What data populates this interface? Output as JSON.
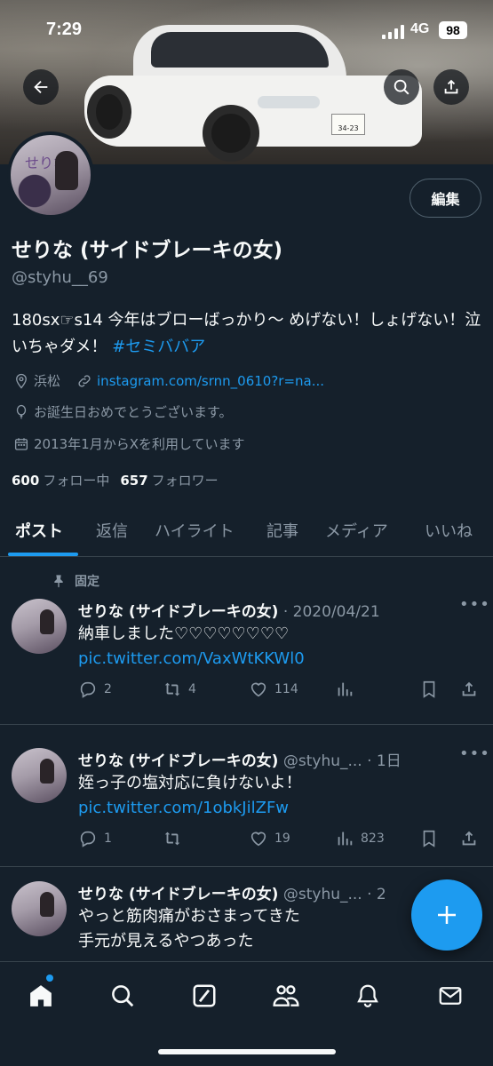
{
  "status_bar": {
    "time": "7:29",
    "network": "4G",
    "battery": "98"
  },
  "banner": {
    "plate_text": "34-23"
  },
  "header": {
    "edit_label": "編集"
  },
  "profile": {
    "display_name": "せりな (サイドブレーキの女)",
    "handle": "@styhu__69",
    "avatar_text": "せりな",
    "bio_text": "180sx☞s14 今年はブローばっかり〜 めげない！しょげない！泣いちゃダメ！ ",
    "bio_hashtag": "#セミババア",
    "location": "浜松",
    "website": "instagram.com/srnn_0610?r=na...",
    "birthday": "お誕生日おめでとうございます。",
    "joined": "2013年1月からXを利用しています",
    "following_count": "600",
    "following_label": "フォロー中",
    "followers_count": "657",
    "followers_label": "フォロワー"
  },
  "tabs": [
    {
      "label": "ポスト"
    },
    {
      "label": "返信"
    },
    {
      "label": "ハイライト"
    },
    {
      "label": "記事"
    },
    {
      "label": "メディア"
    },
    {
      "label": "いいね"
    }
  ],
  "pinned_label": "固定",
  "posts": [
    {
      "name": "せりな (サイドブレーキの女)",
      "meta": " · 2020/04/21",
      "text": "納車しました♡♡♡♡♡♡♡♡ ",
      "link": "pic.twitter.com/VaxWtKKWl0",
      "replies": "2",
      "reposts": "4",
      "likes": "114",
      "views": ""
    },
    {
      "name": "せりな (サイドブレーキの女)",
      "meta": " @styhu_... · 1日",
      "text": "姪っ子の塩対応に負けないよ！ ",
      "link": "pic.twitter.com/1obkJilZFw",
      "replies": "1",
      "reposts": "",
      "likes": "19",
      "views": "823"
    },
    {
      "name": "せりな (サイドブレーキの女)",
      "meta": " @styhu_... · 2",
      "line1": "やっと筋肉痛がおさまってきた",
      "line2": "手元が見えるやつあった"
    }
  ],
  "nav": {
    "items": [
      "home-icon",
      "search-icon",
      "grok-icon",
      "communities-icon",
      "notifications-icon",
      "messages-icon"
    ]
  },
  "colors": {
    "background": "#15202b",
    "accent": "#1d9bf0",
    "muted": "#8b98a5",
    "text": "#f7f9f9"
  }
}
